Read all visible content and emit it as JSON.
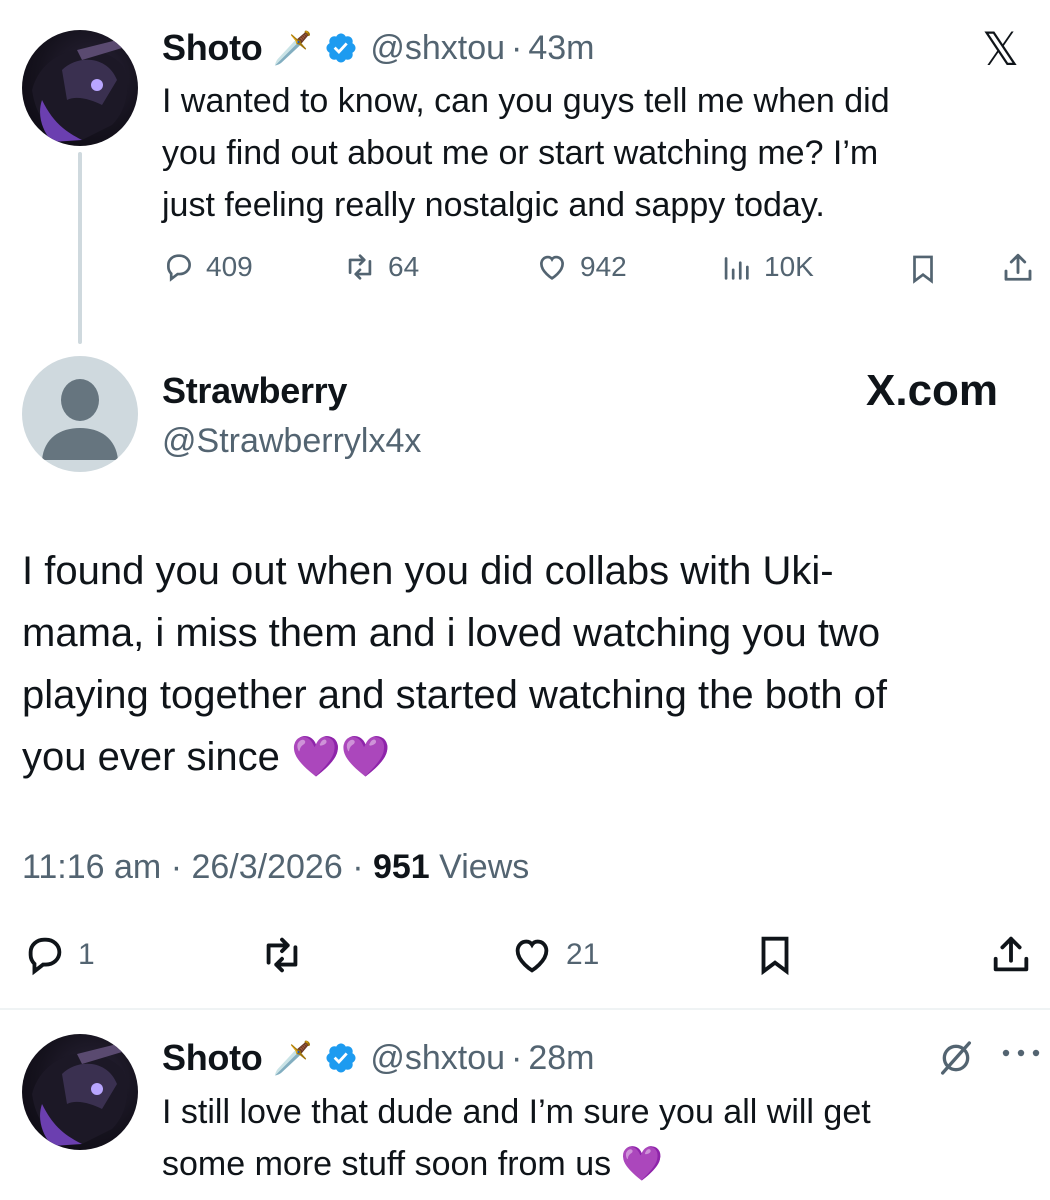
{
  "tweet1": {
    "name": "Shoto",
    "name_emoji": "🗡️",
    "handle": "@shxtou",
    "separator": "·",
    "time": "43m",
    "text_lines": [
      "I wanted to know, can you guys tell me when did",
      "you find out about me or start watching me? I’m",
      "just feeling really nostalgic and sappy today."
    ],
    "stats": {
      "replies": "409",
      "reposts": "64",
      "likes": "942",
      "views": "10K"
    }
  },
  "watermark": {
    "corner": "𝕏",
    "site": "X.com"
  },
  "tweet2": {
    "name": "Strawberry",
    "handle": "@Strawberrylx4x",
    "text_lines": [
      "I found you out when you did collabs with Uki-",
      "mama, i miss them and i loved watching you two",
      "playing together and started watching the both of",
      "you ever since 💜💜"
    ],
    "meta": {
      "time": "11:16 am",
      "sep1": "·",
      "date": "26/3/2026",
      "sep2": "·",
      "views_count": "951",
      "views_label": "Views"
    },
    "stats": {
      "replies": "1",
      "likes": "21"
    }
  },
  "tweet3": {
    "name": "Shoto",
    "name_emoji": "🗡️",
    "handle": "@shxtou",
    "separator": "·",
    "time": "28m",
    "text_lines": [
      "I still love that dude and I’m sure you all will get",
      "some more stuff soon from us 💜"
    ]
  },
  "colors": {
    "verified": "#1d9bf0",
    "muted": "#536471",
    "text": "#0f1419"
  }
}
